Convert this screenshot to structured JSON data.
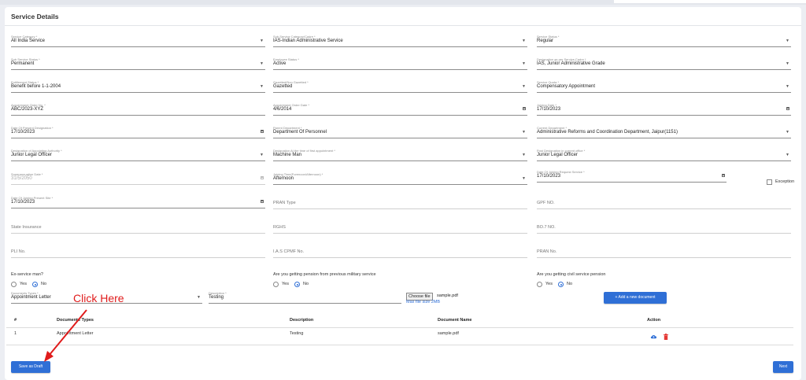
{
  "page_title": "Service Details",
  "fields": {
    "service_category": {
      "label": "Service Category *",
      "value": "All India Service"
    },
    "sub_service_category": {
      "label": "Sub Service Category/Cadre *",
      "value": "IAS-Indian Administrative Service"
    },
    "service_status": {
      "label": "Service Status *",
      "value": "Regular"
    },
    "sub_service_status": {
      "label": "Sub Service Status *",
      "value": "Permanent"
    },
    "employee_status": {
      "label": "Employee Status *",
      "value": "Active"
    },
    "designation_service_cadre": {
      "label": "Designation as per Service Cadre *",
      "value": "IAS, Junior Administrative Grade"
    },
    "entitlement_status": {
      "label": "Entitlement Status *",
      "value": "Benefit before 1-1-2004"
    },
    "gazetted_status": {
      "label": "Gazetted/Non Gazetted *",
      "value": "Gazetted"
    },
    "service_quota": {
      "label": "Service Quota *",
      "value": "Compensatory Appointment"
    },
    "appointment_order_no": {
      "label": "Appointment Order No. *",
      "value": "ABC/2023-XYZ"
    },
    "appointment_order_date": {
      "label": "Appointment Order Date *",
      "value": "4/6/2014"
    },
    "joining_date": {
      "label": "Joining Date *",
      "value": "17/10/2023"
    },
    "date_present_designation": {
      "label": "Date Of Present Designation *",
      "value": "17/10/2023"
    },
    "parent_department": {
      "label": "Parent Department *",
      "value": "Department Of Personnel"
    },
    "current_department": {
      "label": "Current Department *",
      "value": "Administrative Reforms and Coordination Department, Jaipur(1151)"
    },
    "designation_appointing_authority": {
      "label": "Designation of Appointing Authority *",
      "value": "Junior Legal Officer"
    },
    "designation_at_appointment": {
      "label": "Designation At the time of first appointment *",
      "value": "Machine Man"
    },
    "post_designation_current_office": {
      "label": "Post Designation in current office *",
      "value": "Junior Legal Officer"
    },
    "superannuation_date": {
      "label": "Superannuation Date *",
      "value": "31/5/2050"
    },
    "joining_time": {
      "label": "Joining Time(Forenoon/Afternoon) *",
      "value": "Afternoon"
    },
    "date_joining_request_service": {
      "label": "Date Of Joining Request Service *",
      "value": "17/10/2023"
    },
    "date_joining_present_site": {
      "label": "Date Of Joining Present Site *",
      "value": "17/10/2023"
    },
    "pran_type": {
      "placeholder": "PRAN Type"
    },
    "gpf_no": {
      "placeholder": "GPF NO."
    },
    "state_insurance": {
      "placeholder": "State Insurance"
    },
    "rghs": {
      "placeholder": "RGHS"
    },
    "bo7_no": {
      "placeholder": "BO.7 NO."
    },
    "pli_no": {
      "placeholder": "PLI No."
    },
    "ias_cpmf_no": {
      "placeholder": "I.A.S CPMF No."
    },
    "pran_no": {
      "placeholder": "PRAN No."
    },
    "documents_types": {
      "label": "Documents Types *",
      "value": "Appointment Letter"
    },
    "description": {
      "label": "Description *",
      "value": "Testing"
    }
  },
  "exception_label": "Exception",
  "questions": {
    "ex_service": {
      "label": "Ex-service man?",
      "yes": "Yes",
      "no": "No",
      "selected": "No"
    },
    "military_pension": {
      "label": "Are you getting pension from previous military service",
      "yes": "Yes",
      "no": "No",
      "selected": "No"
    },
    "civil_pension": {
      "label": "Are you getting civil service pension",
      "yes": "Yes",
      "no": "No",
      "selected": "No"
    }
  },
  "file_upload": {
    "button_label": "Choose file",
    "file_name": "sample.pdf",
    "hint": "Max file size 2MB"
  },
  "add_document_label": "+ Add a new document",
  "table": {
    "headers": [
      "#",
      "Documents Types",
      "Description",
      "Document Name",
      "Action"
    ],
    "rows": [
      {
        "index": "1",
        "doc_type": "Appointment Letter",
        "description": "Testing",
        "doc_name": "sample.pdf"
      }
    ]
  },
  "footer": {
    "save_draft_label": "Save as Draft",
    "next_label": "Next"
  },
  "annotation": {
    "text": "Click Here"
  },
  "colors": {
    "accent": "#2f6fd6",
    "annotation": "#e01b1b",
    "upload_icon": "#2f6fd6",
    "delete_icon": "#e53935"
  },
  "icons": {
    "upload": "cloud-upload-icon",
    "delete": "trash-icon"
  }
}
